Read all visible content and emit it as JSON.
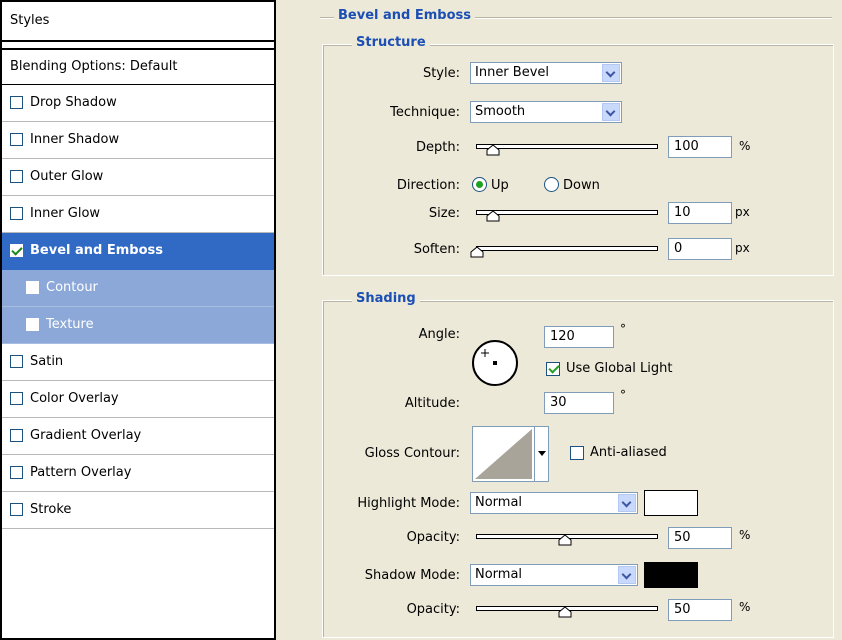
{
  "styles_list": {
    "header": "Styles",
    "blending_options": "Blending Options: Default",
    "items": [
      {
        "label": "Drop Shadow",
        "checked": false
      },
      {
        "label": "Inner Shadow",
        "checked": false
      },
      {
        "label": "Outer Glow",
        "checked": false
      },
      {
        "label": "Inner Glow",
        "checked": false
      },
      {
        "label": "Bevel and Emboss",
        "checked": true,
        "selected": true
      },
      {
        "label": "Contour",
        "checked": false,
        "sub": true
      },
      {
        "label": "Texture",
        "checked": false,
        "sub": true
      },
      {
        "label": "Satin",
        "checked": false
      },
      {
        "label": "Color Overlay",
        "checked": false
      },
      {
        "label": "Gradient Overlay",
        "checked": false
      },
      {
        "label": "Pattern Overlay",
        "checked": false
      },
      {
        "label": "Stroke",
        "checked": false
      }
    ]
  },
  "bevel": {
    "title": "Bevel and Emboss",
    "structure": {
      "title": "Structure",
      "style_label": "Style:",
      "style_value": "Inner Bevel",
      "technique_label": "Technique:",
      "technique_value": "Smooth",
      "depth_label": "Depth:",
      "depth_value": "100",
      "depth_unit": "%",
      "direction_label": "Direction:",
      "direction_up": "Up",
      "direction_down": "Down",
      "direction_selected": "Up",
      "size_label": "Size:",
      "size_value": "10",
      "size_unit": "px",
      "soften_label": "Soften:",
      "soften_value": "0",
      "soften_unit": "px"
    },
    "shading": {
      "title": "Shading",
      "angle_label": "Angle:",
      "angle_value": "120",
      "degree_unit": "°",
      "use_global_light_label": "Use Global Light",
      "use_global_light": true,
      "altitude_label": "Altitude:",
      "altitude_value": "30",
      "gloss_contour_label": "Gloss Contour:",
      "anti_aliased_label": "Anti-aliased",
      "anti_aliased": false,
      "highlight_mode_label": "Highlight Mode:",
      "highlight_mode_value": "Normal",
      "highlight_color": "#ffffff",
      "highlight_opacity_label": "Opacity:",
      "highlight_opacity_value": "50",
      "highlight_opacity_unit": "%",
      "shadow_mode_label": "Shadow Mode:",
      "shadow_mode_value": "Normal",
      "shadow_color": "#000000",
      "shadow_opacity_label": "Opacity:",
      "shadow_opacity_value": "50",
      "shadow_opacity_unit": "%"
    }
  },
  "colors": {
    "selected_row": "#316ac5",
    "sub_row": "#8ca8d8",
    "section_title": "#1b4fb4",
    "dialog_bg": "#ece9d8"
  }
}
